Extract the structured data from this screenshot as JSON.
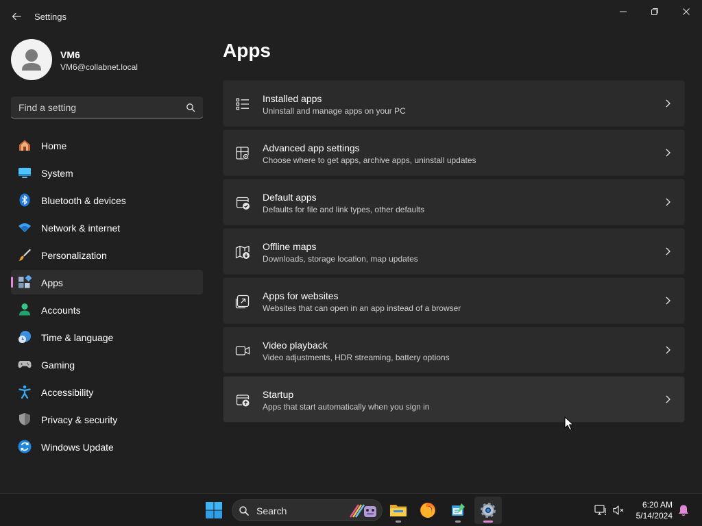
{
  "window": {
    "title": "Settings"
  },
  "profile": {
    "name": "VM6",
    "email": "VM6@collabnet.local"
  },
  "search": {
    "placeholder": "Find a setting"
  },
  "sidebar": {
    "items": [
      {
        "label": "Home",
        "icon": "home-icon",
        "active": false
      },
      {
        "label": "System",
        "icon": "system-icon",
        "active": false
      },
      {
        "label": "Bluetooth & devices",
        "icon": "bluetooth-icon",
        "active": false
      },
      {
        "label": "Network & internet",
        "icon": "wifi-icon",
        "active": false
      },
      {
        "label": "Personalization",
        "icon": "brush-icon",
        "active": false
      },
      {
        "label": "Apps",
        "icon": "apps-icon",
        "active": true
      },
      {
        "label": "Accounts",
        "icon": "accounts-icon",
        "active": false
      },
      {
        "label": "Time & language",
        "icon": "clock-globe-icon",
        "active": false
      },
      {
        "label": "Gaming",
        "icon": "gamepad-icon",
        "active": false
      },
      {
        "label": "Accessibility",
        "icon": "accessibility-icon",
        "active": false
      },
      {
        "label": "Privacy & security",
        "icon": "shield-icon",
        "active": false
      },
      {
        "label": "Windows Update",
        "icon": "update-icon",
        "active": false
      }
    ]
  },
  "main": {
    "title": "Apps",
    "cards": [
      {
        "title": "Installed apps",
        "subtitle": "Uninstall and manage apps on your PC",
        "icon": "list-icon"
      },
      {
        "title": "Advanced app settings",
        "subtitle": "Choose where to get apps, archive apps, uninstall updates",
        "icon": "app-settings-icon"
      },
      {
        "title": "Default apps",
        "subtitle": "Defaults for file and link types, other defaults",
        "icon": "default-apps-icon"
      },
      {
        "title": "Offline maps",
        "subtitle": "Downloads, storage location, map updates",
        "icon": "map-icon"
      },
      {
        "title": "Apps for websites",
        "subtitle": "Websites that can open in an app instead of a browser",
        "icon": "open-in-app-icon"
      },
      {
        "title": "Video playback",
        "subtitle": "Video adjustments, HDR streaming, battery options",
        "icon": "video-icon"
      },
      {
        "title": "Startup",
        "subtitle": "Apps that start automatically when you sign in",
        "icon": "startup-icon"
      }
    ]
  },
  "taskbar": {
    "search_label": "Search",
    "apps": [
      {
        "name": "file-explorer-icon",
        "active": false
      },
      {
        "name": "firefox-icon",
        "active": false
      },
      {
        "name": "notepad-icon",
        "active": false
      },
      {
        "name": "settings-app-icon",
        "active": true
      }
    ],
    "time": "6:20 AM",
    "date": "5/14/2024"
  },
  "colors": {
    "background": "#202020",
    "card": "#2b2b2b",
    "accent": "#e08ad6",
    "taskbar": "#1c1c1c"
  }
}
